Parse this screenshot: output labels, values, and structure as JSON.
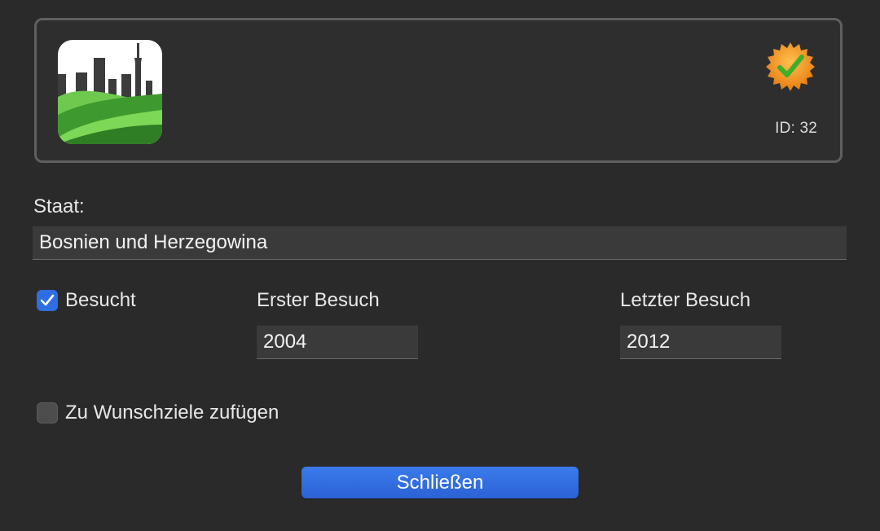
{
  "header": {
    "id_text": "ID: 32"
  },
  "form": {
    "state_label": "Staat:",
    "state_value": "Bosnien und Herzegowina",
    "visited_label": "Besucht",
    "visited_checked": true,
    "first_visit_label": "Erster Besuch",
    "first_visit_value": "2004",
    "last_visit_label": "Letzter Besuch",
    "last_visit_value": "2012",
    "wishlist_label": "Zu Wunschziele zufügen",
    "wishlist_checked": false
  },
  "actions": {
    "close_label": "Schließen"
  },
  "colors": {
    "accent": "#2f6de0",
    "background": "#2a2a2a"
  },
  "icons": {
    "app": "city-landscape-icon",
    "badge": "verified-badge-icon",
    "check": "checkmark-icon"
  }
}
